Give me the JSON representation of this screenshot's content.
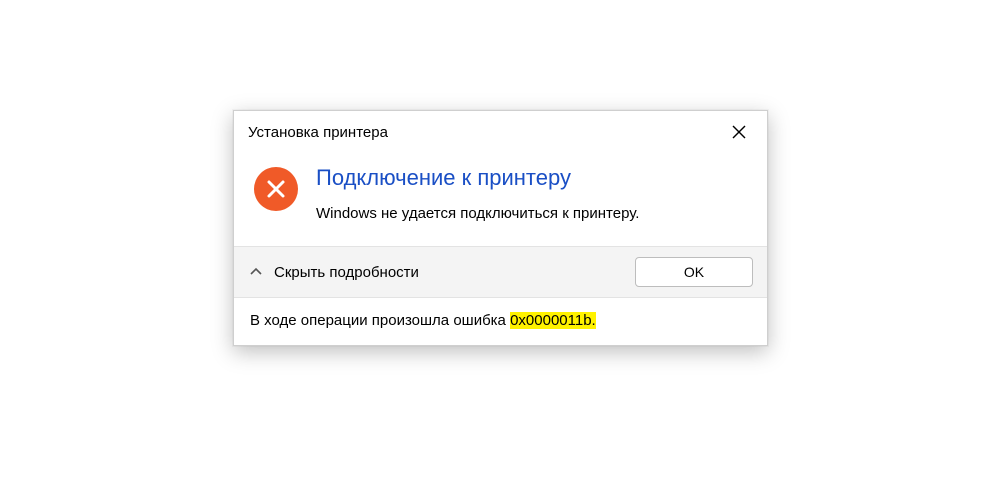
{
  "dialog": {
    "title": "Установка принтера",
    "heading": "Подключение к принтеру",
    "message": "Windows не удается подключиться к принтеру.",
    "details_toggle": "Скрыть подробности",
    "ok_label": "OK",
    "details_prefix": "В ходе операции произошла ошибка ",
    "error_code": "0x0000011b",
    "details_suffix": "."
  },
  "icons": {
    "error": "error-x-icon",
    "close": "close-icon",
    "chevron": "chevron-up-icon"
  },
  "colors": {
    "error_bg": "#f05a28",
    "heading": "#1a4fc5",
    "highlight": "#fff200"
  }
}
